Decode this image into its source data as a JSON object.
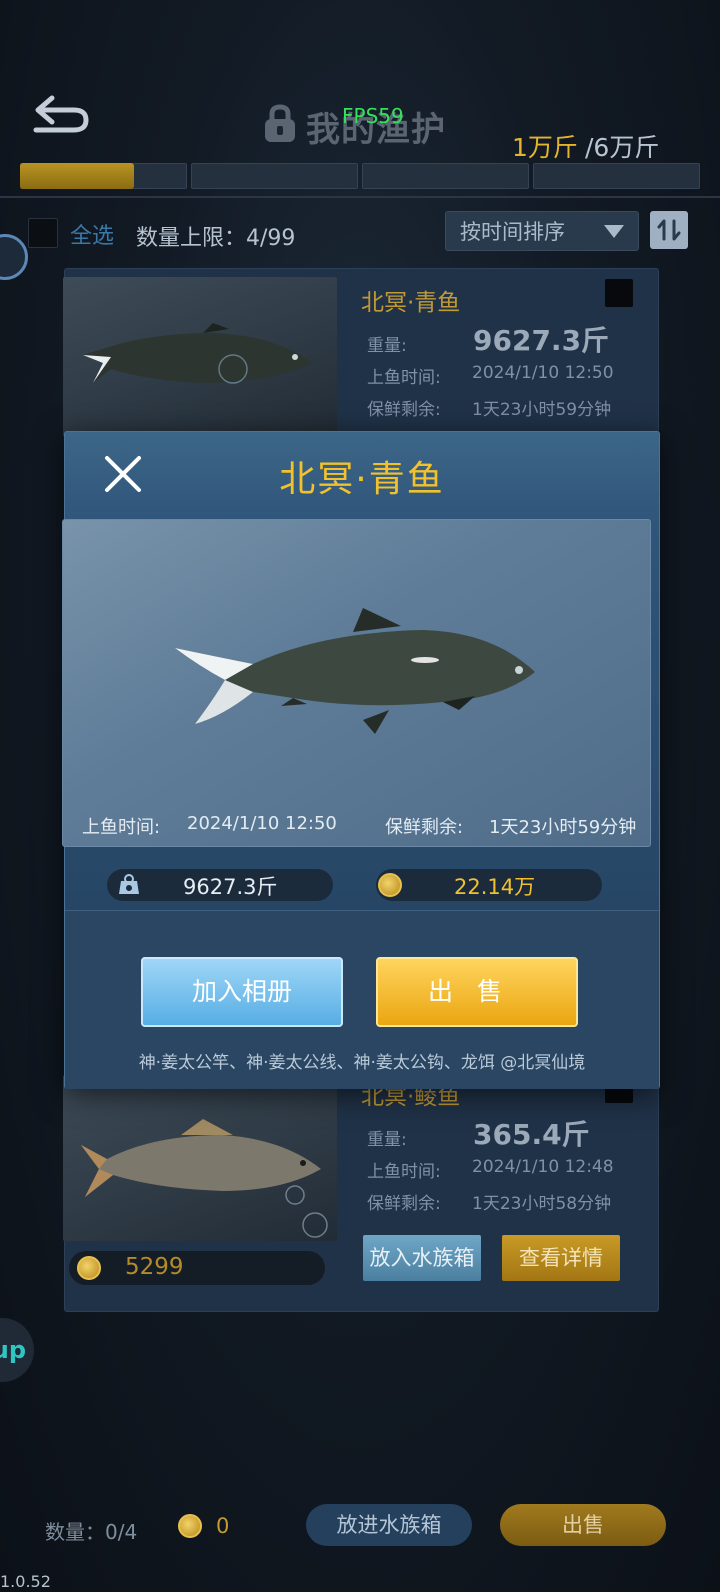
{
  "header": {
    "title": "我的渔护",
    "fps": "FPS59",
    "capacity_used": "1万斤",
    "capacity_total": "/6万斤",
    "capacity_fraction": 0.167
  },
  "toolbar": {
    "select_all": "全选",
    "limit": "数量上限：4/99",
    "sort": "按时间排序"
  },
  "cards": [
    {
      "name": "北冥·青鱼",
      "weight_label": "重量:",
      "weight": "9627.3斤",
      "time_label": "上鱼时间:",
      "time": "2024/1/10  12:50",
      "fresh_label": "保鲜剩余:",
      "fresh": "1天23小时59分钟"
    },
    {
      "name": "北冥·鲮鱼",
      "weight_label": "重量:",
      "weight": "365.4斤",
      "time_label": "上鱼时间:",
      "time": "2024/1/10  12:48",
      "fresh_label": "保鲜剩余:",
      "fresh": "1天23小时58分钟",
      "price": "5299",
      "btn_aquarium": "放入水族箱",
      "btn_detail": "查看详情"
    }
  ],
  "popup": {
    "title": "北冥·青鱼",
    "time_label": "上鱼时间:",
    "time": "2024/1/10  12:50",
    "fresh_label": "保鲜剩余:",
    "fresh": "1天23小时59分钟",
    "weight": "9627.3斤",
    "price": "22.14万",
    "btn_album": "加入相册",
    "btn_sell": "出售",
    "gear": "神·姜太公竿、神·姜太公线、神·姜太公钩、龙饵  @北冥仙境"
  },
  "bottom": {
    "count": "数量：0/4",
    "coins": "0",
    "btn_aquarium": "放进水族箱",
    "btn_sell": "出售"
  },
  "side": {
    "up_label": "up"
  },
  "version": "1.0.52",
  "colors": {
    "gold": "#f2c12c",
    "popup_bg": "#2f557a",
    "sell_btn": "#eaa611",
    "album_btn": "#57aee4"
  }
}
